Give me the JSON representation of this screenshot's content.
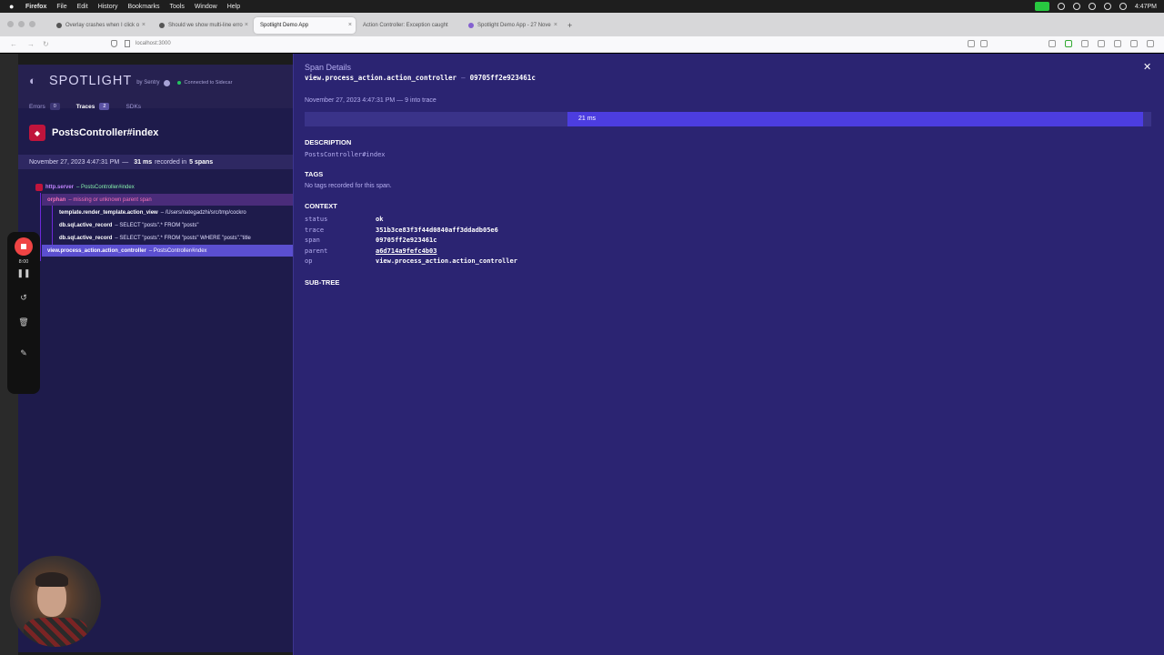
{
  "menubar": {
    "app": "Firefox",
    "items": [
      "File",
      "Edit",
      "History",
      "Bookmarks",
      "Tools",
      "Window",
      "Help"
    ],
    "clock": "4:47PM"
  },
  "browser": {
    "tabs": [
      {
        "label": "Overlay crashes when I click o"
      },
      {
        "label": "Should we show multi-line erro"
      },
      {
        "label": "Spotlight Demo App"
      },
      {
        "label": "Action Controller: Exception caught"
      },
      {
        "label": "Spotlight Demo App - 27 Nove"
      }
    ],
    "url": "localhost:3000"
  },
  "spotlight": {
    "brand": "SPOTLIGHT",
    "by": "by Sentry",
    "connection": "Connected to Sidecar",
    "tabs": [
      {
        "label": "Errors",
        "count": "0"
      },
      {
        "label": "Traces",
        "count": "2"
      },
      {
        "label": "SDKs",
        "count": ""
      }
    ],
    "trace": {
      "title": "PostsController#index",
      "date": "November 27, 2023 4:47:31 PM",
      "sep": "—",
      "duration": "31 ms",
      "recorded_in": "recorded in",
      "spans": "5 spans"
    },
    "span_tree": [
      {
        "op": "http.server",
        "desc": "– PostsController#index"
      },
      {
        "op": "orphan",
        "desc": "– missing or unknown parent span"
      },
      {
        "op": "template.render_template.action_view",
        "desc": "– /Users/nategadzhi/src/tmp/cockro"
      },
      {
        "op": "db.sql.active_record",
        "desc": "– SELECT \"posts\".* FROM \"posts\""
      },
      {
        "op": "db.sql.active_record",
        "desc": "– SELECT \"posts\".* FROM \"posts\" WHERE \"posts\".\"title"
      },
      {
        "op": "view.process_action.action_controller",
        "desc": "– PostsController#index"
      }
    ]
  },
  "recorder": {
    "time": "8:00"
  },
  "detail": {
    "heading": "Span Details",
    "op": "view.process_action.action_controller",
    "dash": "—",
    "span_id": "09705ff2e923461c",
    "when": "November 27, 2023 4:47:31 PM — 9 into trace",
    "bar_label": "21 ms",
    "bar_fraction": 0.68,
    "bar_offset_fraction": 0.31,
    "description_h": "DESCRIPTION",
    "description": "PostsController#index",
    "tags_h": "TAGS",
    "tags": "No tags recorded for this span.",
    "context_h": "CONTEXT",
    "context": [
      {
        "k": "status",
        "v": "ok"
      },
      {
        "k": "trace",
        "v": "351b3ce83f3f44d0840aff3ddadb05e6"
      },
      {
        "k": "span",
        "v": "09705ff2e923461c"
      },
      {
        "k": "parent",
        "v": "a6d714a9fefc4b03"
      },
      {
        "k": "op",
        "v": "view.process_action.action_controller"
      }
    ],
    "subtree_h": "SUB-TREE"
  },
  "colors": {
    "panel": "#2b2472",
    "accent": "#4c3de0",
    "sidebar": "#1e1b4b"
  }
}
